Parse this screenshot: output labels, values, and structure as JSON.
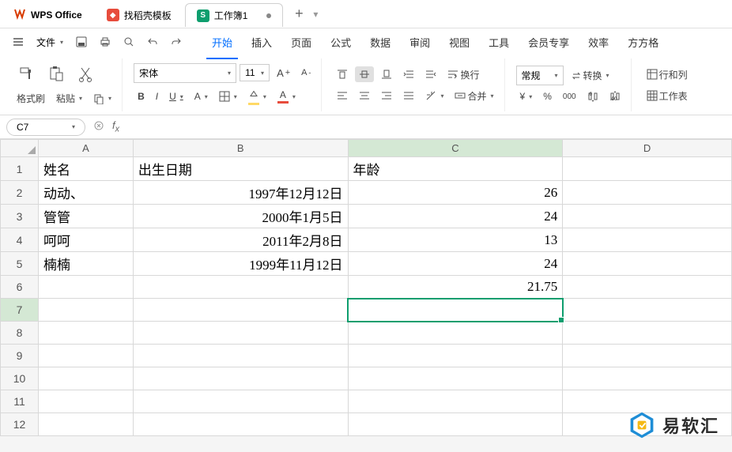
{
  "titlebar": {
    "app_name": "WPS Office",
    "template_tab": "找稻壳模板",
    "doc_icon": "S",
    "doc_name": "工作簿1"
  },
  "menubar": {
    "file": "文件",
    "items": [
      "开始",
      "插入",
      "页面",
      "公式",
      "数据",
      "审阅",
      "视图",
      "工具",
      "会员专享",
      "效率",
      "方方格"
    ],
    "active_index": 0
  },
  "ribbon": {
    "format_painter": "格式刷",
    "paste": "粘贴",
    "font_name": "宋体",
    "font_size": "11",
    "wrap": "换行",
    "merge": "合并",
    "number_format": "常规",
    "transform": "转换",
    "rowcol": "行和列",
    "sheet": "工作表"
  },
  "refbar": {
    "cell": "C7"
  },
  "grid": {
    "cols": [
      "A",
      "B",
      "C",
      "D"
    ],
    "rows": [
      "1",
      "2",
      "3",
      "4",
      "5",
      "6",
      "7",
      "8",
      "9",
      "10",
      "11",
      "12"
    ],
    "data": {
      "A1": "姓名",
      "B1": "出生日期",
      "C1": "年龄",
      "A2": "动动、",
      "B2": "1997年12月12日",
      "C2": "26",
      "A3": "管管",
      "B3": "2000年1月5日",
      "C3": "24",
      "A4": "呵呵",
      "B4": "2011年2月8日",
      "C4": "13",
      "A5": "楠楠",
      "B5": "1999年11月12日",
      "C5": "24",
      "C6": "21.75"
    },
    "active": "C7"
  },
  "watermark": "易软汇"
}
